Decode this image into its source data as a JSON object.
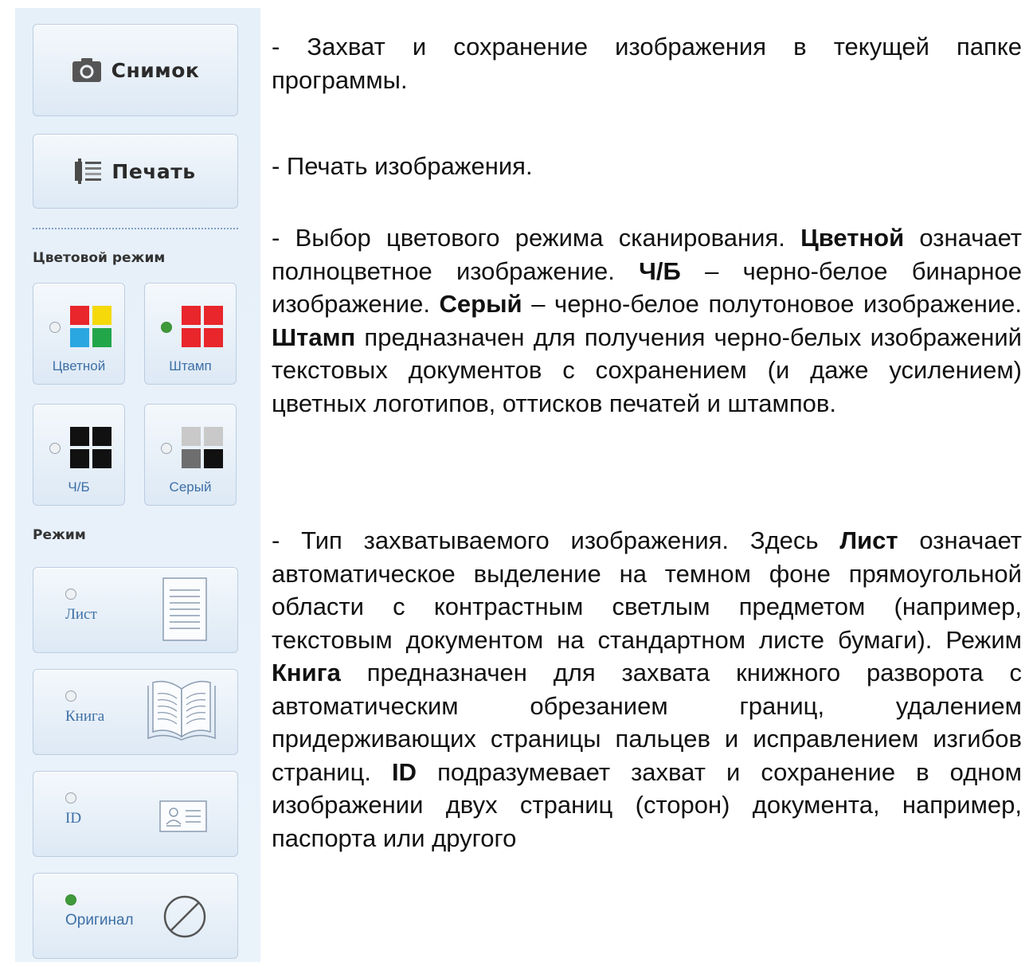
{
  "sidebar": {
    "snapshot_label": "Снимок",
    "print_label": "Печать",
    "color_mode_title": "Цветовой режим",
    "color_modes": [
      {
        "label": "Цветной",
        "selected": false,
        "icon": "color-squares-icon"
      },
      {
        "label": "Штамп",
        "selected": true,
        "icon": "red-squares-icon"
      },
      {
        "label": "Ч/Б",
        "selected": false,
        "icon": "black-squares-icon"
      },
      {
        "label": "Серый",
        "selected": false,
        "icon": "gray-squares-icon"
      }
    ],
    "mode_title": "Режим",
    "modes": [
      {
        "label": "Лист",
        "selected": false,
        "icon": "sheet-icon"
      },
      {
        "label": "Книга",
        "selected": false,
        "icon": "book-icon"
      },
      {
        "label": "ID",
        "selected": false,
        "icon": "id-card-icon"
      },
      {
        "label": "Оригинал",
        "selected": true,
        "icon": "no-processing-icon"
      }
    ],
    "colors": {
      "red": "#e8262b",
      "yellow": "#f5d90a",
      "blue": "#2aa7e0",
      "green": "#22a64a",
      "black": "#111111",
      "gray": "#c9c9c9",
      "darkgray": "#6e6e6e",
      "radio_on": "#3f9a3a"
    }
  },
  "text": {
    "p1": "- Захват и сохранение изображения в текущей папке программы.",
    "p2": "- Печать изображения.",
    "p3_a": "- Выбор цветового режима сканирования. ",
    "p3_b1": "Цветной",
    "p3_c": " означает полноцветное изображение. ",
    "p3_b2": "Ч/Б",
    "p3_d": " – черно-белое бинарное изображение. ",
    "p3_b3": "Серый",
    "p3_e": " – черно-белое полутоновое изображение. ",
    "p3_b4": "Штамп",
    "p3_f": " предназначен для получения черно-белых изображений текстовых документов с сохранением (и даже усилением) цветных логотипов, оттисков печатей и штампов.",
    "p4_a": "- Тип захватываемого изображения. Здесь ",
    "p4_b1": "Лист",
    "p4_c": " означает автоматическое выделение на темном фоне прямоугольной области с контрастным светлым предметом (например, текстовым документом на стандартном листе бумаги). Режим ",
    "p4_b2": "Книга",
    "p4_d": " предназначен для захвата книжного разворота с автоматическим обрезанием границ, удалением придерживающих страницы пальцев и исправлением изгибов страниц. ",
    "p4_b3": "ID",
    "p4_e": " подразумевает захват и сохранение в одном изображении двух страниц (сторон) документа, например, паспорта или другого"
  }
}
